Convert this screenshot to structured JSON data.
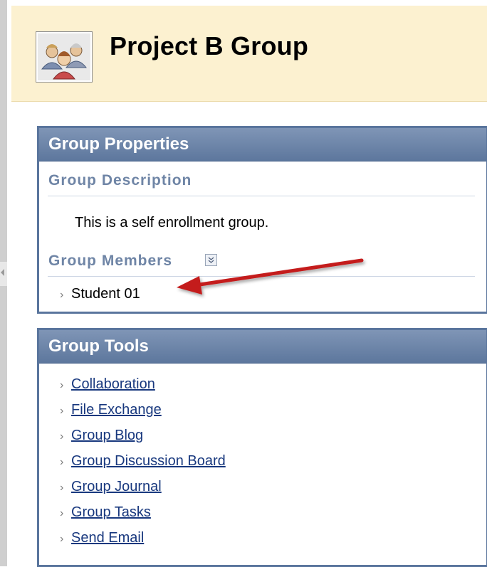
{
  "header": {
    "title": "Project B Group",
    "icon": "group-people-icon"
  },
  "group_properties": {
    "heading": "Group Properties",
    "description_heading": "Group Description",
    "description_text": "This is a self enrollment group.",
    "members_heading": "Group Members",
    "members_toggle_icon": "double-chevron-down-icon",
    "members": [
      "Student 01"
    ]
  },
  "group_tools": {
    "heading": "Group Tools",
    "items": [
      "Collaboration",
      "File Exchange",
      "Group Blog",
      "Group Discussion Board",
      "Group Journal",
      "Group Tasks",
      "Send Email"
    ]
  },
  "colors": {
    "header_bg": "#fcf1d0",
    "panel_border": "#5a759d",
    "panel_head": "#6a82a8",
    "subheading": "#6f85a6",
    "annotation_arrow": "#c41a1a"
  }
}
